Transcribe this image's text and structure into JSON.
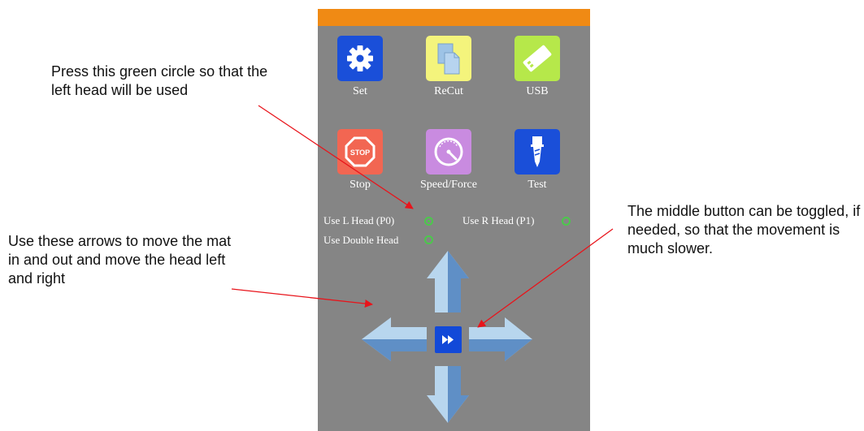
{
  "callouts": {
    "left_head": "Press this green circle so that the left head will be used",
    "arrows": "Use these arrows to move the mat in and out and move the head left and right",
    "middle_button": "The middle button can be toggled, if needed, so that the movement is much slower."
  },
  "tiles": [
    {
      "label": "Set",
      "icon": "gear-icon",
      "color": "#1a4fd9"
    },
    {
      "label": "ReCut",
      "icon": "copy-pages-icon",
      "color": "#f4f47c"
    },
    {
      "label": "USB",
      "icon": "usb-drive-icon",
      "color": "#b6e84a"
    },
    {
      "label": "Stop",
      "icon": "stop-sign-icon",
      "color": "#f26652"
    },
    {
      "label": "Speed/Force",
      "icon": "gauge-icon",
      "color": "#c98be0"
    },
    {
      "label": "Test",
      "icon": "cutter-blade-icon",
      "color": "#1a4fd9"
    }
  ],
  "options": {
    "left_head": "Use L Head (P0)",
    "right_head": "Use R Head (P1)",
    "double_head": "Use Double Head"
  },
  "selected_option": "left_head",
  "colors": {
    "top_bar": "#f08a14",
    "panel": "#858585",
    "annotation_arrow": "#e8141b",
    "radio": "#4bc94b",
    "arrow_light": "#b8d6ee",
    "arrow_dark": "#5f8fc6",
    "slow_button": "#1249d8"
  },
  "slow_button_icon": "fast-forward-icon"
}
